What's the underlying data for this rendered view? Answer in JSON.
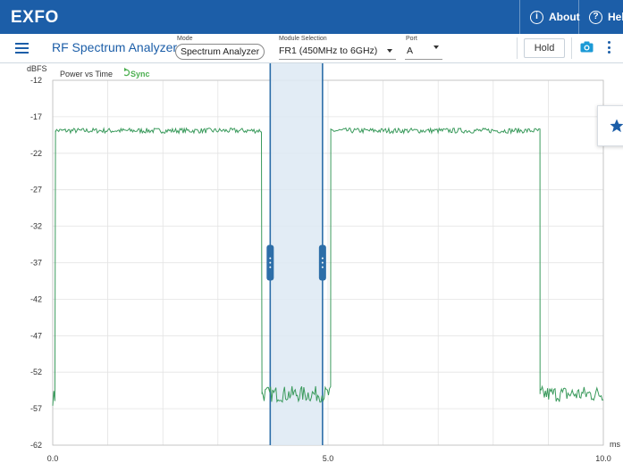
{
  "header": {
    "logo": "EXFO",
    "about_label": "About",
    "help_label": "Help",
    "brand_color": "#1c5ea8"
  },
  "toolbar": {
    "app_title": "RF Spectrum Analyzer",
    "mode_label": "Mode",
    "mode_value": "Spectrum Analyzer",
    "module_label": "Module Selection",
    "module_value": "FR1 (450MHz to 6GHz)",
    "port_label": "Port",
    "port_value": "A",
    "hold_label": "Hold",
    "icons": [
      "menu-icon",
      "camera-icon",
      "more-vertical-icon"
    ]
  },
  "plot": {
    "title": "Power vs Time",
    "sync_label": "Sync",
    "y_unit": "dBFS",
    "x_unit": "ms",
    "trace_color": "#3a9a5c",
    "gate_color": "#2d6ea8"
  },
  "chart_data": {
    "type": "line",
    "title": "Power vs Time",
    "ylabel": "dBFS",
    "xlabel": "ms",
    "ylim": [
      -62,
      -12
    ],
    "xlim": [
      0,
      10
    ],
    "y_ticks": [
      "-12",
      "-17",
      "-22",
      "-27",
      "-32",
      "-37",
      "-42",
      "-47",
      "-52",
      "-57",
      "-62"
    ],
    "x_ticks": [
      "0.0",
      "5.0",
      "10.0"
    ],
    "grid": true,
    "series": [
      {
        "segments": [
          {
            "x": [
              0.0,
              0.05
            ],
            "level": -55.5
          },
          {
            "x": [
              0.05,
              3.8
            ],
            "level": -18.9
          },
          {
            "x": [
              3.8,
              5.05
            ],
            "level": -55.0
          },
          {
            "x": [
              5.05,
              8.85
            ],
            "level": -18.9
          },
          {
            "x": [
              8.85,
              10.0
            ],
            "level": -55.0
          }
        ]
      }
    ],
    "gate": {
      "start": 3.95,
      "end": 4.9
    }
  },
  "side_panel": {
    "icon": "star-icon"
  }
}
